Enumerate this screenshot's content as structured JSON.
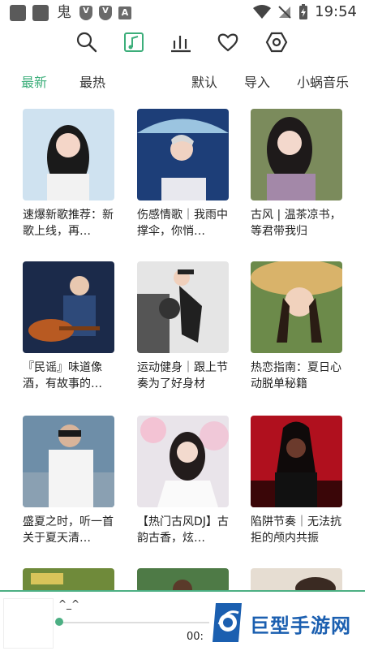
{
  "status_bar": {
    "time": "19:54",
    "app_glyph": "鬼",
    "letter_badge": "A"
  },
  "toolbar": {
    "icons": [
      "search-icon",
      "music-note-icon",
      "bar-chart-icon",
      "heart-icon",
      "hexagon-settings-icon"
    ],
    "active_color": "#3cae7a"
  },
  "tabs": {
    "latest": "最新",
    "hottest": "最热",
    "default": "默认",
    "import": "导入",
    "snail_music": "小蜗音乐"
  },
  "playlists": [
    {
      "title": "速爆新歌推荐：新歌上线，再…"
    },
    {
      "title": "伤感情歌｜我雨中撑伞，你悄…"
    },
    {
      "title": "古风 | 温茶凉书，等君带我归"
    },
    {
      "title": "『民谣』味道像酒，有故事的…"
    },
    {
      "title": "运动健身｜跟上节奏为了好身材"
    },
    {
      "title": "热恋指南：夏日心动脱单秘籍"
    },
    {
      "title": "盛夏之时，听一首关于夏天清…"
    },
    {
      "title": "【热门古风DJ】古韵古香，炫…"
    },
    {
      "title": "陷阱节奏｜无法抗拒的颅内共振"
    }
  ],
  "player": {
    "song": "^_^",
    "time": "00:",
    "progress": 0.0
  },
  "watermark": {
    "text": "巨型手游网"
  }
}
